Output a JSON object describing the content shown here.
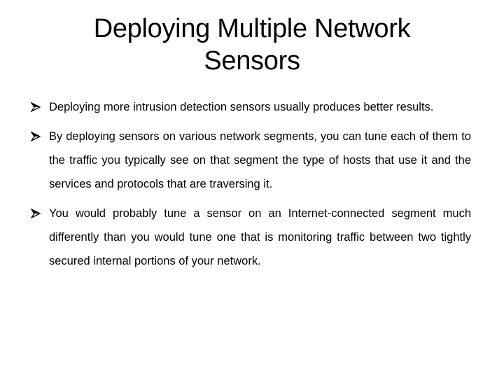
{
  "slide": {
    "title": "Deploying Multiple Network Sensors",
    "bullet_icon": "arrow-bullet-icon",
    "bullets": [
      {
        "text": "Deploying more intrusion detection sensors usually produces better results."
      },
      {
        "text": "By deploying sensors on various network segments, you can tune each of them to the traffic you typically see on that segment the type of hosts that use it and the services and protocols that are traversing it."
      },
      {
        "text": "You would probably tune a sensor on an Internet-connected segment much differently than you would tune one that is monitoring traffic between two tightly secured internal portions of your network."
      }
    ]
  }
}
